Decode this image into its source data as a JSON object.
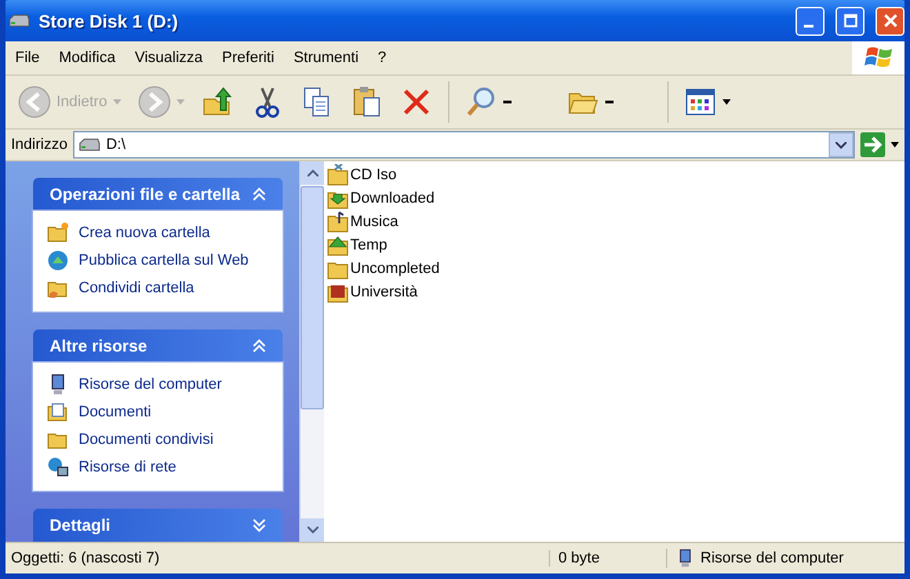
{
  "window": {
    "title": "Store Disk 1 (D:)"
  },
  "menu": [
    "File",
    "Modifica",
    "Visualizza",
    "Preferiti",
    "Strumenti",
    "?"
  ],
  "toolbar": [
    {
      "kind": "back",
      "label": "Indietro",
      "disabled": true
    },
    {
      "kind": "forward",
      "disabled": true
    },
    {
      "kind": "up"
    },
    {
      "kind": "cut"
    },
    {
      "kind": "copy"
    },
    {
      "kind": "paste"
    },
    {
      "kind": "delete"
    },
    {
      "kind": "search"
    },
    {
      "kind": "folders"
    },
    {
      "kind": "views"
    }
  ],
  "address": {
    "label": "Indirizzo",
    "value": "D:\\"
  },
  "task_panels": [
    {
      "title": "Operazioni file e cartella",
      "expanded": true,
      "items": [
        {
          "kind": "new-folder",
          "label": "Crea nuova cartella"
        },
        {
          "kind": "globe",
          "label": "Pubblica cartella sul Web"
        },
        {
          "kind": "share",
          "label": "Condividi cartella"
        }
      ]
    },
    {
      "title": "Altre risorse",
      "expanded": true,
      "items": [
        {
          "kind": "computer",
          "label": "Risorse del computer"
        },
        {
          "kind": "documents",
          "label": "Documenti"
        },
        {
          "kind": "folder",
          "label": "Documenti condivisi"
        },
        {
          "kind": "network",
          "label": "Risorse di rete"
        }
      ]
    },
    {
      "title": "Dettagli",
      "expanded": false
    }
  ],
  "files": [
    {
      "kind": "cd",
      "name": "CD Iso"
    },
    {
      "kind": "download",
      "name": "Downloaded"
    },
    {
      "kind": "music",
      "name": "Musica"
    },
    {
      "kind": "up",
      "name": "Temp"
    },
    {
      "kind": "folder",
      "name": "Uncompleted"
    },
    {
      "kind": "film",
      "name": "Università"
    }
  ],
  "status_bar": {
    "objects": "Oggetti: 6 (nascosti 7)",
    "size": "0 byte",
    "location": "Risorse del computer"
  }
}
